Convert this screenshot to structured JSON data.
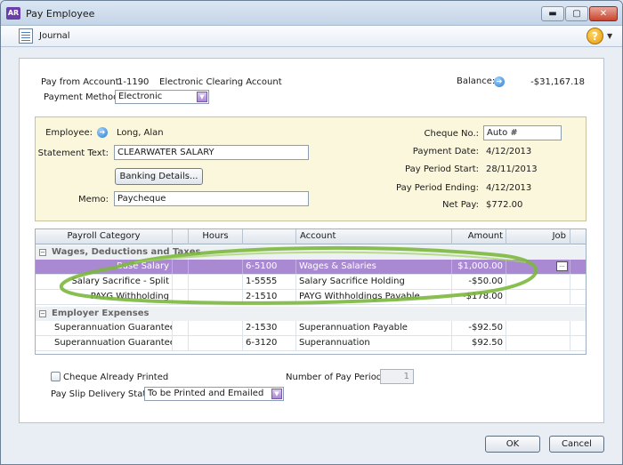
{
  "window": {
    "app_badge": "AR",
    "title": "Pay Employee",
    "controls": {
      "minimize": "▬",
      "maximize": "▢",
      "close": "✕"
    }
  },
  "toolbar": {
    "journal_label": "Journal",
    "help_label": "?"
  },
  "header": {
    "pay_from_label": "Pay from Account:",
    "pay_from_code": "1-1190",
    "pay_from_name": "Electronic Clearing Account",
    "payment_method_label": "Payment Method:",
    "payment_method_value": "Electronic",
    "balance_label": "Balance:",
    "balance_value": "-$31,167.18"
  },
  "employee_panel": {
    "employee_label": "Employee:",
    "employee_value": "Long, Alan",
    "statement_text_label": "Statement Text:",
    "statement_text_value": "CLEARWATER SALARY",
    "banking_button": "Banking Details...",
    "memo_label": "Memo:",
    "memo_value": "Paycheque",
    "cheque_no_label": "Cheque No.:",
    "cheque_no_value": "Auto #",
    "payment_date_label": "Payment Date:",
    "payment_date_value": "4/12/2013",
    "period_start_label": "Pay Period Start:",
    "period_start_value": "28/11/2013",
    "period_end_label": "Pay Period Ending:",
    "period_end_value": "4/12/2013",
    "net_pay_label": "Net Pay:",
    "net_pay_value": "$772.00"
  },
  "grid": {
    "columns": [
      "Payroll Category",
      "Hours",
      "Account",
      "Amount",
      "Job"
    ],
    "groups": [
      {
        "name": "Wages, Deductions and Taxes",
        "rows": [
          {
            "category": "Base Salary",
            "hours": "",
            "code": "6-5100",
            "account": "Wages & Salaries",
            "amount": "$1,000.00",
            "job": ""
          },
          {
            "category": "Salary Sacrifice - Split",
            "hours": "",
            "code": "1-5555",
            "account": "Salary Sacrifice Holding",
            "amount": "-$50.00",
            "job": ""
          },
          {
            "category": "PAYG Withholding",
            "hours": "",
            "code": "2-1510",
            "account": "PAYG Withholdings Payable",
            "amount": "-$178.00",
            "job": ""
          }
        ]
      },
      {
        "name": "Employer Expenses",
        "rows": [
          {
            "category": "Superannuation Guarantee",
            "hours": "",
            "code": "2-1530",
            "account": "Superannuation Payable",
            "amount": "-$92.50",
            "job": ""
          },
          {
            "category": "Superannuation Guarantee",
            "hours": "",
            "code": "6-3120",
            "account": "Superannuation",
            "amount": "$92.50",
            "job": ""
          }
        ]
      }
    ],
    "job_button": "..."
  },
  "bottom": {
    "cheque_printed_label": "Cheque Already Printed",
    "num_periods_label": "Number of Pay Periods:",
    "num_periods_value": "1",
    "delivery_label": "Pay Slip Delivery Status:",
    "delivery_value": "To be Printed and Emailed"
  },
  "footer": {
    "ok": "OK",
    "cancel": "Cancel"
  },
  "colors": {
    "selected_row": "#a989d2",
    "highlight_ellipse": "#7cb83e",
    "panel_yellow": "#fbf7dc"
  }
}
